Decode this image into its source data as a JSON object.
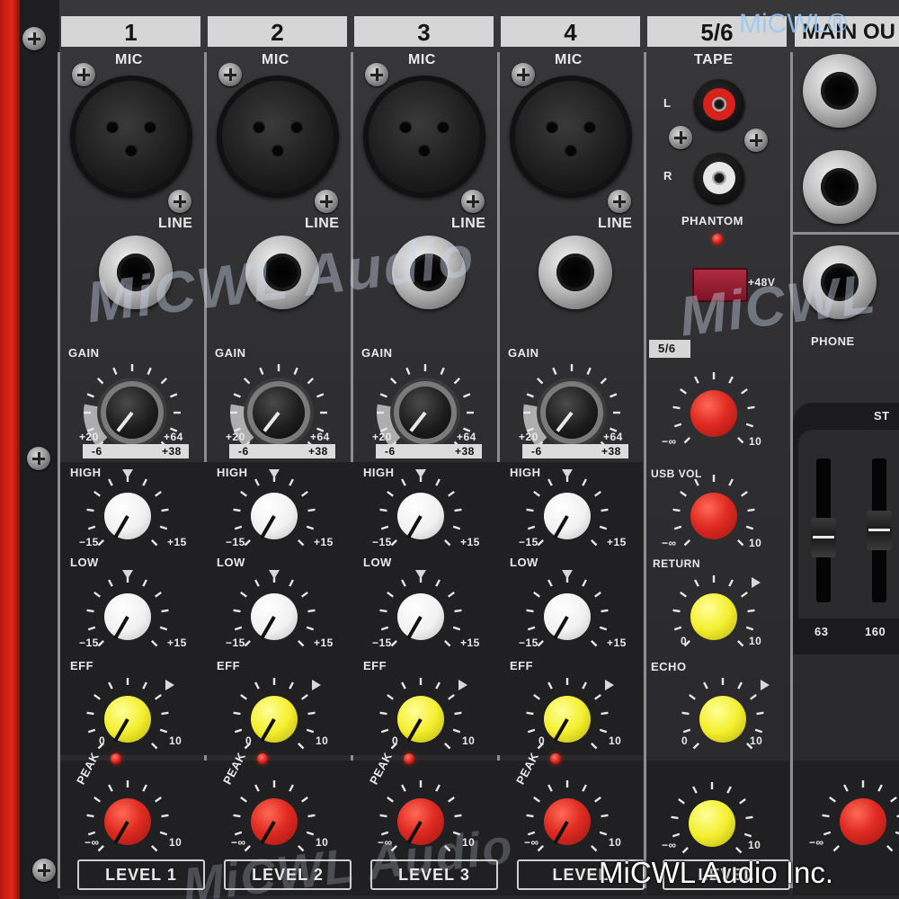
{
  "channels": [
    {
      "number": "1",
      "level": "LEVEL 1"
    },
    {
      "number": "2",
      "level": "LEVEL 2"
    },
    {
      "number": "3",
      "level": "LEVEL 3"
    },
    {
      "number": "4",
      "level": "LEVEL"
    }
  ],
  "labels": {
    "mic": "MIC",
    "line": "LINE",
    "gain": "GAIN",
    "gain_min": "+20",
    "gain_max": "+64",
    "gain_line_min": "-6",
    "gain_line_max": "+38",
    "high": "HIGH",
    "low": "LOW",
    "eq_min": "−15",
    "eq_max": "+15",
    "eff": "EFF",
    "zero": "0",
    "ten": "10",
    "inf": "−∞",
    "peak": "PEAK"
  },
  "stereo": {
    "header": "5/6",
    "tape": "TAPE",
    "left": "L",
    "right": "R",
    "phantom": "PHANTOM",
    "p48": "+48V",
    "sub_header": "5/6",
    "usb_vol": "USB VOL",
    "return": "RETURN",
    "echo": "ECHO",
    "level": "LEVEL"
  },
  "main": {
    "header": "MAIN OU",
    "phone": "PHONE",
    "eq_label": "ST",
    "freq1": "63",
    "freq2": "160"
  },
  "watermark": {
    "big": "MiCWL Audio",
    "right": "MiCWL",
    "top_tag": "MiCWL®",
    "footer": "MiCWL Audio Inc."
  }
}
